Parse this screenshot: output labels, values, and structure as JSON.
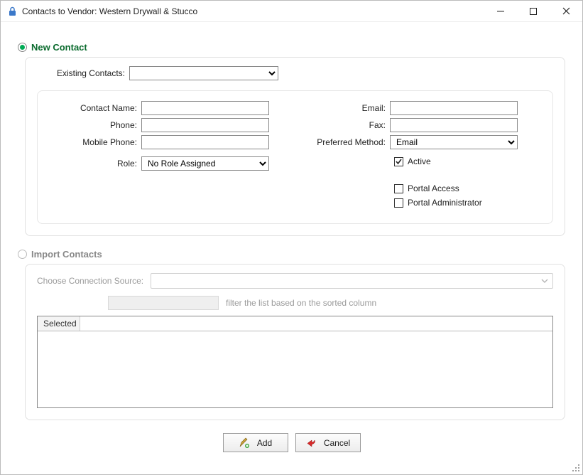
{
  "window": {
    "title": "Contacts to Vendor: Western Drywall & Stucco"
  },
  "mode": {
    "newContactLabel": "New Contact",
    "importLabel": "Import Contacts"
  },
  "existing": {
    "label": "Existing Contacts:",
    "value": ""
  },
  "fields": {
    "contactName": {
      "label": "Contact Name:",
      "value": ""
    },
    "phone": {
      "label": "Phone:",
      "value": ""
    },
    "mobilePhone": {
      "label": "Mobile Phone:",
      "value": ""
    },
    "role": {
      "label": "Role:",
      "value": "No Role Assigned"
    },
    "email": {
      "label": "Email:",
      "value": ""
    },
    "fax": {
      "label": "Fax:",
      "value": ""
    },
    "preferred": {
      "label": "Preferred Method:",
      "value": "Email"
    },
    "active": {
      "label": "Active"
    },
    "portalAccess": {
      "label": "Portal Access"
    },
    "portalAdmin": {
      "label": "Portal Administrator"
    }
  },
  "import": {
    "sourceLabel": "Choose Connection Source:",
    "filterHint": "filter the list based on the sorted column",
    "gridHeaders": {
      "selected": "Selected"
    }
  },
  "buttons": {
    "add": "Add",
    "cancel": "Cancel"
  }
}
